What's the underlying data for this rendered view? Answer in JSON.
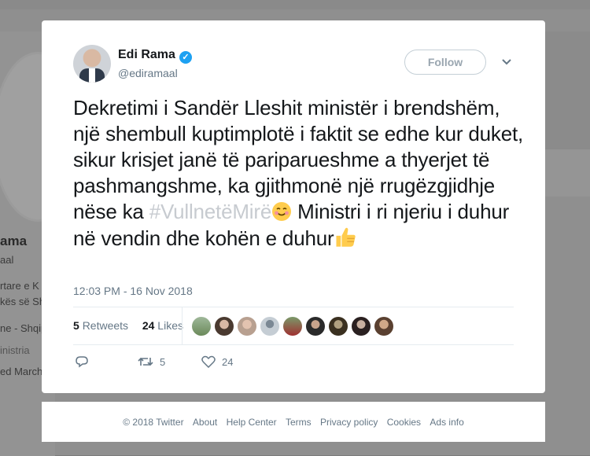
{
  "background": {
    "name_fragment": "ama",
    "handle_fragment": "aal",
    "line1": "rtare e K",
    "line2": "kës së Sh",
    "line3": "ne - Shqip",
    "line4": "inistria",
    "line5": "ed March"
  },
  "tweet": {
    "author_name": "Edi Rama",
    "author_handle": "@ediramaal",
    "follow_label": "Follow",
    "text_part1": "Dekretimi i Sandër Lleshit ministër i brendshëm, një shembull kuptimplotë i faktit se edhe kur duket, sikur krisjet janë të pariparueshme a thyerjet të pashmangshme, ka gjithmonë një rrugëzgjidhje nëse ka ",
    "hashtag": "#VullnetëMirë",
    "text_part2": " Ministri i ri njeriu i duhur në vendin dhe kohën e duhur",
    "timestamp": "12:03 PM - 16 Nov 2018",
    "retweets_count": "5",
    "retweets_label": "Retweets",
    "likes_count": "24",
    "likes_label": "Likes",
    "reply_icon": "reply-icon",
    "retweet_icon": "retweet-icon",
    "like_icon": "heart-icon",
    "action_retweets": "5",
    "action_likes": "24",
    "accent_color": "#1da1f2"
  },
  "footer": {
    "links": [
      "© 2018 Twitter",
      "About",
      "Help Center",
      "Terms",
      "Privacy policy",
      "Cookies",
      "Ads info"
    ]
  }
}
